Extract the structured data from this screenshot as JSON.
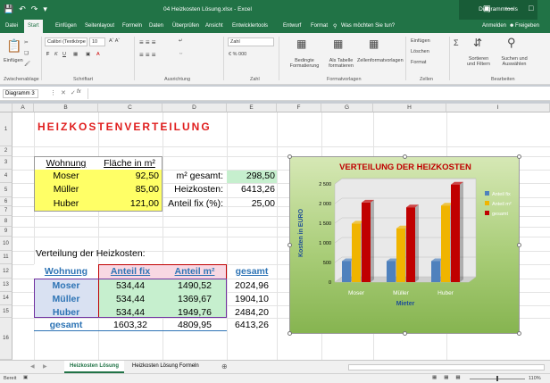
{
  "window": {
    "title": "04 Heizkosten Lösung.xlsx - Excel",
    "context_tab": "Diagrammtools"
  },
  "menu": {
    "tabs": [
      "Datei",
      "Start",
      "Einfügen",
      "Seitenlayout",
      "Formeln",
      "Daten",
      "Überprüfen",
      "Ansicht",
      "Entwicklertools",
      "Entwurf",
      "Format"
    ],
    "tellme": "Was möchten Sie tun?",
    "signin": "Anmelden",
    "share": "Freigeben"
  },
  "ribbon": {
    "paste": "Einfügen",
    "font_name": "Calibri (Textkörpe",
    "font_size": "10",
    "number_format": "Zahl",
    "cond_format": "Bedingte Formatierung",
    "as_table": "Als Tabelle formatieren",
    "cell_styles": "Zellenformatvorlagen",
    "insert": "Einfügen",
    "delete": "Löschen",
    "format": "Format",
    "sort": "Sortieren und Filtern",
    "find": "Suchen und Auswählen",
    "groups": [
      "Zwischenablage",
      "Schriftart",
      "Ausrichtung",
      "Zahl",
      "Formatvorlagen",
      "Zellen",
      "Bearbeiten"
    ]
  },
  "formula_bar": {
    "name_box": "Diagramm 3",
    "fx": "fx"
  },
  "columns": [
    "A",
    "B",
    "C",
    "D",
    "E",
    "F",
    "G",
    "H",
    "I"
  ],
  "rows": [
    "1",
    "2",
    "3",
    "4",
    "5",
    "6",
    "7",
    "8",
    "9",
    "10",
    "11",
    "12",
    "13",
    "14",
    "15",
    "16"
  ],
  "sheet": {
    "title": "HEIZKOSTENVERTEILUNG",
    "t1_headers": [
      "Wohnung",
      "Fläche in m²"
    ],
    "t1_rows": [
      [
        "Moser",
        "92,50"
      ],
      [
        "Müller",
        "85,00"
      ],
      [
        "Huber",
        "121,00"
      ]
    ],
    "info": [
      [
        "m² gesamt:",
        "298,50"
      ],
      [
        "Heizkosten:",
        "6413,26"
      ],
      [
        "Anteil fix (%):",
        "25,00"
      ]
    ],
    "dist_label": "Verteilung der Heizkosten:",
    "t2_headers": [
      "Wohnung",
      "Anteil fix",
      "Anteil m²",
      "gesamt"
    ],
    "t2_rows": [
      [
        "Moser",
        "534,44",
        "1490,52",
        "2024,96"
      ],
      [
        "Müller",
        "534,44",
        "1369,67",
        "1904,10"
      ],
      [
        "Huber",
        "534,44",
        "1949,76",
        "2484,20"
      ]
    ],
    "t2_total": [
      "gesamt",
      "1603,32",
      "4809,95",
      "6413,26"
    ]
  },
  "chart_data": {
    "type": "bar",
    "title": "VERTEILUNG DER HEIZKOSTEN",
    "xlabel": "Mieter",
    "ylabel": "Kosten in EURO",
    "categories": [
      "Moser",
      "Müller",
      "Huber"
    ],
    "series": [
      {
        "name": "Anteil fix",
        "color": "#4f81bd",
        "values": [
          534.44,
          534.44,
          534.44
        ]
      },
      {
        "name": "Anteil m²",
        "color": "#f0b400",
        "values": [
          1490.52,
          1369.67,
          1949.76
        ]
      },
      {
        "name": "gesamt",
        "color": "#c00000",
        "values": [
          2024.96,
          1904.1,
          2484.2
        ]
      }
    ],
    "ylim": [
      0,
      2500
    ],
    "yticks": [
      "0",
      "500",
      "1 000",
      "1 500",
      "2 000",
      "2 500"
    ],
    "legend": "right"
  },
  "sheet_tabs": [
    "Heizkosten Lösung",
    "Heizkosten Lösung Formeln"
  ],
  "status": {
    "mode": "Bereit",
    "zoom": "110%"
  }
}
